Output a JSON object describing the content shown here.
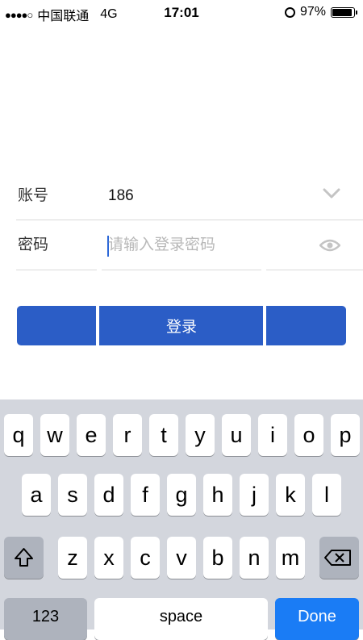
{
  "status_bar": {
    "signal": "●●●●○",
    "carrier": "中国联通",
    "network": "4G",
    "time": "17:01",
    "battery": "97%"
  },
  "form": {
    "account": {
      "label": "账号",
      "value": "186"
    },
    "password": {
      "label": "密码",
      "placeholder": "请输入登录密码"
    }
  },
  "login_button": "登录",
  "keyboard": {
    "row1": [
      "q",
      "w",
      "e",
      "r",
      "t",
      "y",
      "u",
      "i",
      "o",
      "p"
    ],
    "row2": [
      "a",
      "s",
      "d",
      "f",
      "g",
      "h",
      "j",
      "k",
      "l"
    ],
    "row3": [
      "z",
      "x",
      "c",
      "v",
      "b",
      "n",
      "m"
    ],
    "numbers_key": "123",
    "space_key": "space",
    "done_key": "Done"
  }
}
